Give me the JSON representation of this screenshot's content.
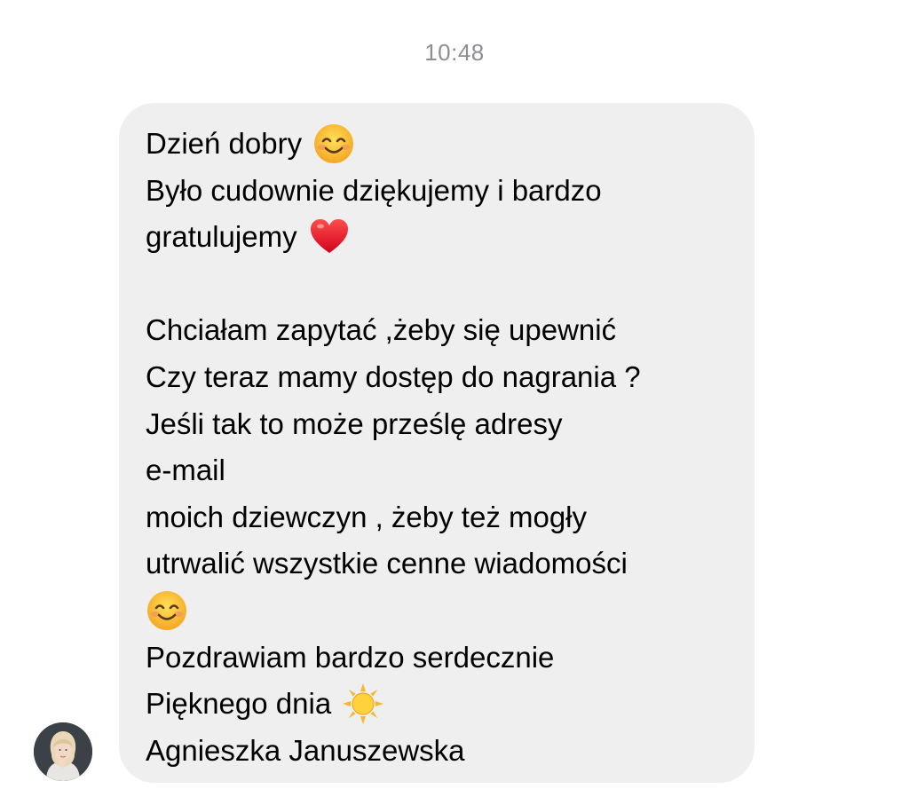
{
  "chat": {
    "timestamp": "10:48"
  },
  "message": {
    "sender_avatar": "avatar-photo",
    "lines": [
      {
        "text": "Dzień dobry",
        "emoji": "smiling-face-icon"
      },
      {
        "text": "Było cudownie dziękujemy i bardzo",
        "emoji": null
      },
      {
        "text": "gratulujemy",
        "emoji": "red-heart-icon"
      },
      {
        "text": "",
        "emoji": null
      },
      {
        "text": "Chciałam zapytać ,żeby się upewnić",
        "emoji": null
      },
      {
        "text": "Czy teraz mamy dostęp do nagrania ?",
        "emoji": null
      },
      {
        "text": "Jeśli tak to może prześlę adresy",
        "emoji": null
      },
      {
        "text": "e-mail",
        "emoji": null
      },
      {
        "text": "moich dziewczyn , żeby też mogły",
        "emoji": null
      },
      {
        "text": "utrwalić wszystkie cenne wiadomości",
        "emoji": null
      },
      {
        "text": "",
        "emoji": "smiling-face-icon"
      },
      {
        "text": "Pozdrawiam bardzo serdecznie",
        "emoji": null
      },
      {
        "text": "Pięknego dnia",
        "emoji": "sun-icon"
      },
      {
        "text": "Agnieszka Januszewska",
        "emoji": null
      }
    ]
  },
  "colors": {
    "bubble_background": "#efefef",
    "timestamp_text": "#8e8e93",
    "message_text": "#000000"
  }
}
